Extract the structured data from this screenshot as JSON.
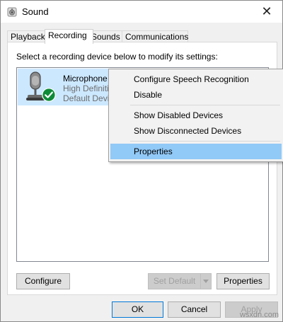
{
  "window": {
    "title": "Sound",
    "close_symbol": "✕"
  },
  "tabs": [
    {
      "label": "Playback",
      "active": false
    },
    {
      "label": "Recording",
      "active": true
    },
    {
      "label": "Sounds",
      "active": false
    },
    {
      "label": "Communications",
      "active": false
    }
  ],
  "panel": {
    "instruction": "Select a recording device below to modify its settings:"
  },
  "device": {
    "name": "Microphone",
    "line1": "High Definiti",
    "line2": "Default Devic",
    "icon": "microphone-icon",
    "status_icon": "default-check-icon",
    "status_color": "#0e8a38"
  },
  "context_menu": {
    "items": [
      {
        "label": "Configure Speech Recognition",
        "highlighted": false
      },
      {
        "label": "Disable",
        "highlighted": false
      },
      {
        "label": "Show Disabled Devices",
        "highlighted": false
      },
      {
        "label": "Show Disconnected Devices",
        "highlighted": false
      },
      {
        "label": "Properties",
        "highlighted": true
      }
    ],
    "highlight_color": "#91c9f7"
  },
  "buttons": {
    "configure": "Configure",
    "set_default": "Set Default",
    "properties": "Properties",
    "ok": "OK",
    "cancel": "Cancel",
    "apply": "Apply"
  },
  "watermark": "wsxdn.com"
}
